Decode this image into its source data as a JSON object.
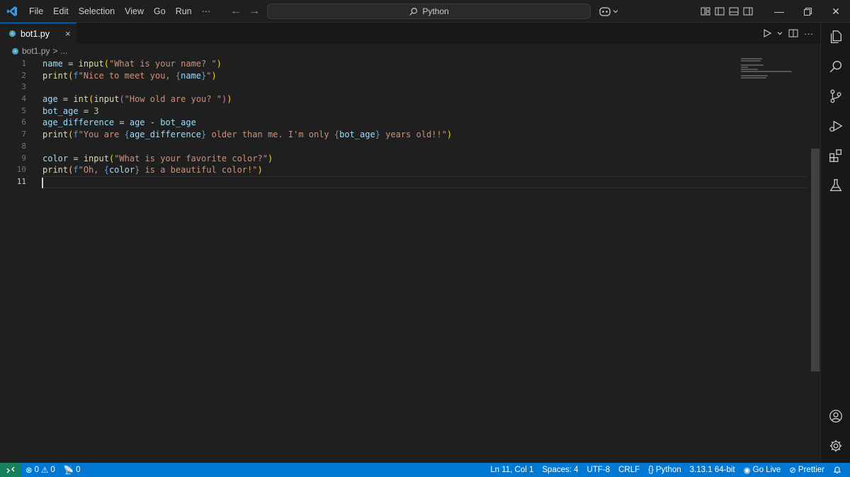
{
  "menu": {
    "items": [
      "File",
      "Edit",
      "Selection",
      "View",
      "Go",
      "Run",
      "···"
    ]
  },
  "command_center": {
    "text": "Python"
  },
  "tabs": [
    {
      "label": "bot1.py",
      "close": "×"
    }
  ],
  "breadcrumb": {
    "file": "bot1.py",
    "sep": ">",
    "more": "..."
  },
  "editor": {
    "line_numbers": [
      "1",
      "2",
      "3",
      "4",
      "5",
      "6",
      "7",
      "8",
      "9",
      "10",
      "11"
    ],
    "lines": [
      "name = input(\"What is your name? \")",
      "print(f\"Nice to meet you, {name}\")",
      "",
      "age = int(input(\"How old are you? \"))",
      "bot_age = 3",
      "age_difference = age - bot_age",
      "print(f\"You are {age_difference} older than me. I'm only {bot_age} years old!!\")",
      "",
      "color = input(\"What is your favorite color?\")",
      "print(f\"Oh, {color} is a beautiful color!\")",
      ""
    ]
  },
  "status": {
    "errors": "0",
    "warnings": "0",
    "ports": "0",
    "position": "Ln 11, Col 1",
    "spaces": "Spaces: 4",
    "encoding": "UTF-8",
    "eol": "CRLF",
    "language": "Python",
    "interpreter": "3.13.1 64-bit",
    "go_live": "Go Live",
    "prettier": "Prettier"
  },
  "colors": {
    "accent": "#0078d4",
    "statusbar": "#0078d4",
    "remote": "#16825d",
    "python_icon": "#519aba"
  }
}
